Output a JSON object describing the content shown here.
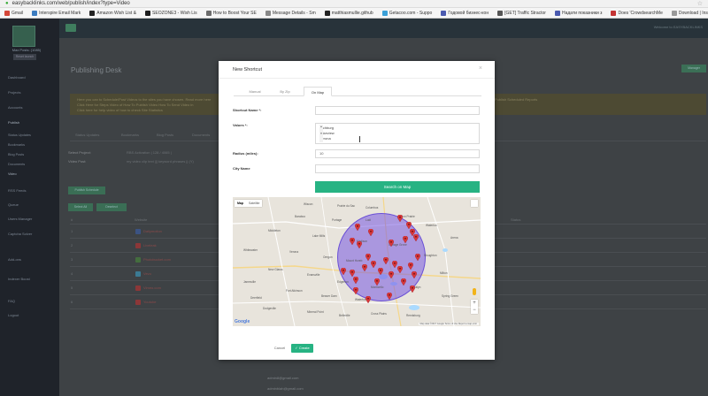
{
  "browser": {
    "url": "easybacklinks.com/web/publish/index?type=Video",
    "bookmarks": [
      {
        "label": "Gmail",
        "color": "#d44638"
      },
      {
        "label": "Interspire Email Mark",
        "color": "#3b7bbf"
      },
      {
        "label": "Amazon Wish List &",
        "color": "#222222"
      },
      {
        "label": "SEOZONE3 - Wish Lis",
        "color": "#1d1d1d"
      },
      {
        "label": "How to Boost Your SE",
        "color": "#6b6b6b"
      },
      {
        "label": "Message Details - Sm",
        "color": "#888888"
      },
      {
        "label": "matthiasmullie.github",
        "color": "#222222"
      },
      {
        "label": "Getacoo.com - Suppo",
        "color": "#3aa0d8"
      },
      {
        "label": "Годовой бизнес-кон",
        "color": "#4a5ab0"
      },
      {
        "label": "[GET] Traffic Stractor",
        "color": "#555555"
      },
      {
        "label": "Надати показники з",
        "color": "#4a5ab0"
      },
      {
        "label": "Does 'CrowdsearchMe",
        "color": "#c33333"
      },
      {
        "label": "Download | InstaBuild",
        "color": "#999999"
      }
    ]
  },
  "app": {
    "sidebar": {
      "user_caption": "Max Posts: (1085)",
      "user_button": "Reset launch",
      "items": [
        {
          "label": "Dashboard"
        },
        {
          "label": "Projects"
        },
        {
          "label": "Accounts"
        },
        {
          "label": "Publish"
        },
        {
          "label": "Status Updates"
        },
        {
          "label": "Bookmarks"
        },
        {
          "label": "Blog Posts"
        },
        {
          "label": "Documents"
        },
        {
          "label": "Video"
        },
        {
          "label": "RSS Feeds"
        },
        {
          "label": "Queue"
        },
        {
          "label": "Users Manager"
        },
        {
          "label": "Captcha Solver"
        },
        {
          "label": "Add-ons"
        },
        {
          "label": "Indexer Boost"
        },
        {
          "label": "FAQ"
        },
        {
          "label": "Logout"
        }
      ]
    },
    "top_user": "Welcome to EASYBACKLINKS",
    "page_title": "Publishing Desk",
    "page_button": "Manager",
    "notice_lines": [
      "Here you can to Schedule/Post Videos to the sites you have chosen. Read more here",
      "Click Here for Steps Video of How To Publish Video    How To Send Video in",
      "Click here for help video of how to check Site Statistics"
    ],
    "notice_right": "Publish Scheduled Reports",
    "sub_tabs": [
      "Status Updates",
      "Bookmarks",
      "Blog Posts",
      "Documents"
    ],
    "select_project_label": "Select Project:",
    "select_project_value": "RBS Activation | 128 / 4065 |",
    "video_post_label": "Video Post:",
    "video_post_value": "my video clip text ||| keyword phrases || (Y)",
    "publish_btn": "Publish Schedule",
    "select_all_btn": "Select All",
    "deselect_btn": "Deselect",
    "table_hash": "#",
    "table_website": "Website",
    "table_status": "Status",
    "row_numbers": [
      "1",
      "2",
      "3",
      "4",
      "5",
      "6"
    ],
    "sites": [
      {
        "name": "Dailymotion",
        "color": "#3a5fae"
      },
      {
        "name": "Liveleak",
        "color": "#c23030"
      },
      {
        "name": "Photobucket.com",
        "color": "#4a8a3a"
      },
      {
        "name": "Vevo",
        "color": "#3aa0c8"
      },
      {
        "name": "Vimeo.com",
        "color": "#c23030"
      },
      {
        "name": "Youtube",
        "color": "#c23030"
      }
    ],
    "emails": [
      "admin8@gmail.com",
      "adminblah@gmail.com",
      "backlinks88@gmail.com"
    ]
  },
  "modal": {
    "title": "New Shortcut",
    "close": "×",
    "tabs": [
      {
        "label": "Manual",
        "active": false
      },
      {
        "label": "By Zip",
        "active": false
      },
      {
        "label": "On Map",
        "active": true
      }
    ],
    "shortcut_name_label": "Shortcut Name *:",
    "shortcut_name_value": "",
    "values_label": "Values *:",
    "values": [
      "Richburg",
      "Lakeview",
      "Verona"
    ],
    "radius_label": "Radius (miles):",
    "radius_value": "10",
    "city_name_label": "City Name",
    "city_name_value": "",
    "search_button": "Search on Map",
    "cancel_button": "Cancel",
    "create_button": "✓ Create",
    "accent_color": "#27b383"
  },
  "map": {
    "type_buttons": [
      "Map",
      "Satellite"
    ],
    "active_type": "Map",
    "zoom_in": "+",
    "zoom_out": "−",
    "logo": "Google",
    "footer": "Map data ©2017 Google   Terms of Use   Report a map error",
    "radius_color": "#7658e1",
    "pin_color": "#d9363a",
    "cities": [
      "Wiscon",
      "Prairie du Sac",
      "Columbus",
      "Baraboo",
      "Portage",
      "Lodi",
      "Sun Prairie",
      "Waterloo",
      "Middleton",
      "Lake Mills",
      "Madison",
      "Cottage Grove",
      "Verona",
      "Oregon",
      "Mount Horeb",
      "Stoughton",
      "New Glarus",
      "Evansville",
      "Edgerton",
      "Monticello",
      "Brooklyn",
      "Fort Atkinson",
      "Beaver Dam",
      "Watertown",
      "Whitewater",
      "Janesville",
      "Milton",
      "Dodgeville",
      "Mineral Point",
      "Belleville",
      "Cross Plains",
      "Reedsburg",
      "Spring Green",
      "Arena",
      "Deerfield"
    ],
    "pins_count": 30
  }
}
